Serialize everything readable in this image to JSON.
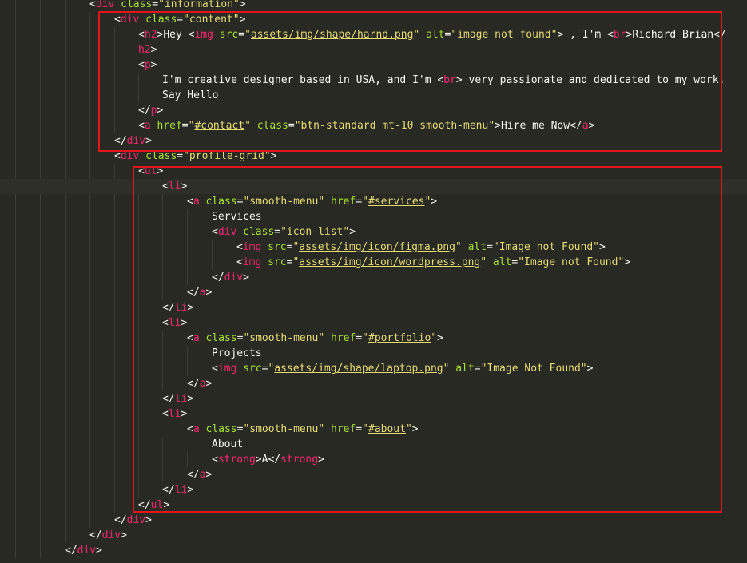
{
  "editor": {
    "colors": {
      "background": "#282923",
      "tag": "#f92672",
      "attribute": "#a6e22e",
      "string": "#e6db74",
      "text": "#f8f8f2",
      "highlight_box": "#e0161b"
    },
    "highlight_boxes": [
      "content block",
      "profile-grid list"
    ],
    "lines": [
      {
        "segments": [
          {
            "t": "punc",
            "v": "<"
          },
          {
            "t": "tag",
            "v": "div"
          },
          {
            "t": "punc",
            "v": " "
          },
          {
            "t": "attr",
            "v": "class"
          },
          {
            "t": "punc",
            "v": "="
          },
          {
            "t": "str",
            "v": "\"information\""
          },
          {
            "t": "punc",
            "v": ">"
          }
        ]
      },
      {
        "segments": [
          {
            "t": "punc",
            "v": "<"
          },
          {
            "t": "tag",
            "v": "div"
          },
          {
            "t": "punc",
            "v": " "
          },
          {
            "t": "attr",
            "v": "class"
          },
          {
            "t": "punc",
            "v": "="
          },
          {
            "t": "str",
            "v": "\"content\""
          },
          {
            "t": "punc",
            "v": ">"
          }
        ]
      },
      {
        "segments": [
          {
            "t": "punc",
            "v": "<"
          },
          {
            "t": "tag",
            "v": "h2"
          },
          {
            "t": "punc",
            "v": ">"
          },
          {
            "t": "text",
            "v": "Hey "
          },
          {
            "t": "punc",
            "v": "<"
          },
          {
            "t": "tag",
            "v": "img"
          },
          {
            "t": "punc",
            "v": " "
          },
          {
            "t": "attr",
            "v": "src"
          },
          {
            "t": "punc",
            "v": "="
          },
          {
            "t": "str",
            "v": "\""
          },
          {
            "t": "link",
            "v": "assets/img/shape/harnd.png"
          },
          {
            "t": "str",
            "v": "\""
          },
          {
            "t": "punc",
            "v": " "
          },
          {
            "t": "attr",
            "v": "alt"
          },
          {
            "t": "punc",
            "v": "="
          },
          {
            "t": "str",
            "v": "\"image not found\""
          },
          {
            "t": "punc",
            "v": ">"
          },
          {
            "t": "text",
            "v": " , I'm "
          },
          {
            "t": "punc",
            "v": "<"
          },
          {
            "t": "tag",
            "v": "br"
          },
          {
            "t": "punc",
            "v": ">"
          },
          {
            "t": "text",
            "v": "Richard Brian"
          },
          {
            "t": "punc",
            "v": "</"
          }
        ]
      },
      {
        "segments": [
          {
            "t": "tag",
            "v": "h2"
          },
          {
            "t": "punc",
            "v": ">"
          }
        ]
      },
      {
        "segments": [
          {
            "t": "punc",
            "v": "<"
          },
          {
            "t": "tag",
            "v": "p"
          },
          {
            "t": "punc",
            "v": ">"
          }
        ]
      },
      {
        "segments": [
          {
            "t": "text",
            "v": "I'm creative designer based in USA, and I'm "
          },
          {
            "t": "punc",
            "v": "<"
          },
          {
            "t": "tag",
            "v": "br"
          },
          {
            "t": "punc",
            "v": ">"
          },
          {
            "t": "text",
            "v": " very passionate and dedicated to my work."
          }
        ]
      },
      {
        "segments": [
          {
            "t": "text",
            "v": "Say Hello"
          }
        ]
      },
      {
        "segments": [
          {
            "t": "punc",
            "v": "</"
          },
          {
            "t": "tag",
            "v": "p"
          },
          {
            "t": "punc",
            "v": ">"
          }
        ]
      },
      {
        "segments": [
          {
            "t": "punc",
            "v": "<"
          },
          {
            "t": "tag",
            "v": "a"
          },
          {
            "t": "punc",
            "v": " "
          },
          {
            "t": "attr",
            "v": "href"
          },
          {
            "t": "punc",
            "v": "="
          },
          {
            "t": "str",
            "v": "\""
          },
          {
            "t": "link",
            "v": "#contact"
          },
          {
            "t": "str",
            "v": "\""
          },
          {
            "t": "punc",
            "v": " "
          },
          {
            "t": "attr",
            "v": "class"
          },
          {
            "t": "punc",
            "v": "="
          },
          {
            "t": "str",
            "v": "\"btn-standard mt-10 smooth-menu\""
          },
          {
            "t": "punc",
            "v": ">"
          },
          {
            "t": "text",
            "v": "Hire me Now"
          },
          {
            "t": "punc",
            "v": "</"
          },
          {
            "t": "tag",
            "v": "a"
          },
          {
            "t": "punc",
            "v": ">"
          }
        ]
      },
      {
        "segments": [
          {
            "t": "punc",
            "v": "</"
          },
          {
            "t": "tag",
            "v": "div"
          },
          {
            "t": "punc",
            "v": ">"
          }
        ]
      },
      {
        "segments": [
          {
            "t": "punc",
            "v": "<"
          },
          {
            "t": "tag",
            "v": "div"
          },
          {
            "t": "punc",
            "v": " "
          },
          {
            "t": "attr",
            "v": "class"
          },
          {
            "t": "punc",
            "v": "="
          },
          {
            "t": "str",
            "v": "\"profile-grid\""
          },
          {
            "t": "punc",
            "v": ">"
          }
        ]
      },
      {
        "segments": [
          {
            "t": "punc",
            "v": "<"
          },
          {
            "t": "tag",
            "v": "ul"
          },
          {
            "t": "punc",
            "v": ">"
          }
        ]
      },
      {
        "segments": [
          {
            "t": "punc",
            "v": "<"
          },
          {
            "t": "tag",
            "v": "li"
          },
          {
            "t": "punc",
            "v": ">"
          }
        ]
      },
      {
        "segments": [
          {
            "t": "punc",
            "v": "<"
          },
          {
            "t": "tag",
            "v": "a"
          },
          {
            "t": "punc",
            "v": " "
          },
          {
            "t": "attr",
            "v": "class"
          },
          {
            "t": "punc",
            "v": "="
          },
          {
            "t": "str",
            "v": "\"smooth-menu\""
          },
          {
            "t": "punc",
            "v": " "
          },
          {
            "t": "attr",
            "v": "href"
          },
          {
            "t": "punc",
            "v": "="
          },
          {
            "t": "str",
            "v": "\""
          },
          {
            "t": "link",
            "v": "#services"
          },
          {
            "t": "str",
            "v": "\""
          },
          {
            "t": "punc",
            "v": ">"
          }
        ]
      },
      {
        "segments": [
          {
            "t": "text",
            "v": "Services"
          }
        ]
      },
      {
        "segments": [
          {
            "t": "punc",
            "v": "<"
          },
          {
            "t": "tag",
            "v": "div"
          },
          {
            "t": "punc",
            "v": " "
          },
          {
            "t": "attr",
            "v": "class"
          },
          {
            "t": "punc",
            "v": "="
          },
          {
            "t": "str",
            "v": "\"icon-list\""
          },
          {
            "t": "punc",
            "v": ">"
          }
        ]
      },
      {
        "segments": [
          {
            "t": "punc",
            "v": "<"
          },
          {
            "t": "tag",
            "v": "img"
          },
          {
            "t": "punc",
            "v": " "
          },
          {
            "t": "attr",
            "v": "src"
          },
          {
            "t": "punc",
            "v": "="
          },
          {
            "t": "str",
            "v": "\""
          },
          {
            "t": "link",
            "v": "assets/img/icon/figma.png"
          },
          {
            "t": "str",
            "v": "\""
          },
          {
            "t": "punc",
            "v": " "
          },
          {
            "t": "attr",
            "v": "alt"
          },
          {
            "t": "punc",
            "v": "="
          },
          {
            "t": "str",
            "v": "\"Image not Found\""
          },
          {
            "t": "punc",
            "v": ">"
          }
        ]
      },
      {
        "segments": [
          {
            "t": "punc",
            "v": "<"
          },
          {
            "t": "tag",
            "v": "img"
          },
          {
            "t": "punc",
            "v": " "
          },
          {
            "t": "attr",
            "v": "src"
          },
          {
            "t": "punc",
            "v": "="
          },
          {
            "t": "str",
            "v": "\""
          },
          {
            "t": "link",
            "v": "assets/img/icon/wordpress.png"
          },
          {
            "t": "str",
            "v": "\""
          },
          {
            "t": "punc",
            "v": " "
          },
          {
            "t": "attr",
            "v": "alt"
          },
          {
            "t": "punc",
            "v": "="
          },
          {
            "t": "str",
            "v": "\"Image not Found\""
          },
          {
            "t": "punc",
            "v": ">"
          }
        ]
      },
      {
        "segments": [
          {
            "t": "punc",
            "v": "</"
          },
          {
            "t": "tag",
            "v": "div"
          },
          {
            "t": "punc",
            "v": ">"
          }
        ]
      },
      {
        "segments": [
          {
            "t": "punc",
            "v": "</"
          },
          {
            "t": "tag",
            "v": "a"
          },
          {
            "t": "punc",
            "v": ">"
          }
        ]
      },
      {
        "segments": [
          {
            "t": "punc",
            "v": "</"
          },
          {
            "t": "tag",
            "v": "li"
          },
          {
            "t": "punc",
            "v": ">"
          }
        ]
      },
      {
        "segments": [
          {
            "t": "punc",
            "v": "<"
          },
          {
            "t": "tag",
            "v": "li"
          },
          {
            "t": "punc",
            "v": ">"
          }
        ]
      },
      {
        "segments": [
          {
            "t": "punc",
            "v": "<"
          },
          {
            "t": "tag",
            "v": "a"
          },
          {
            "t": "punc",
            "v": " "
          },
          {
            "t": "attr",
            "v": "class"
          },
          {
            "t": "punc",
            "v": "="
          },
          {
            "t": "str",
            "v": "\"smooth-menu\""
          },
          {
            "t": "punc",
            "v": " "
          },
          {
            "t": "attr",
            "v": "href"
          },
          {
            "t": "punc",
            "v": "="
          },
          {
            "t": "str",
            "v": "\""
          },
          {
            "t": "link",
            "v": "#portfolio"
          },
          {
            "t": "str",
            "v": "\""
          },
          {
            "t": "punc",
            "v": ">"
          }
        ]
      },
      {
        "segments": [
          {
            "t": "text",
            "v": "Projects"
          }
        ]
      },
      {
        "segments": [
          {
            "t": "punc",
            "v": "<"
          },
          {
            "t": "tag",
            "v": "img"
          },
          {
            "t": "punc",
            "v": " "
          },
          {
            "t": "attr",
            "v": "src"
          },
          {
            "t": "punc",
            "v": "="
          },
          {
            "t": "str",
            "v": "\""
          },
          {
            "t": "link",
            "v": "assets/img/shape/laptop.png"
          },
          {
            "t": "str",
            "v": "\""
          },
          {
            "t": "punc",
            "v": " "
          },
          {
            "t": "attr",
            "v": "alt"
          },
          {
            "t": "punc",
            "v": "="
          },
          {
            "t": "str",
            "v": "\"Image Not Found\""
          },
          {
            "t": "punc",
            "v": ">"
          }
        ]
      },
      {
        "segments": [
          {
            "t": "punc",
            "v": "</"
          },
          {
            "t": "tag",
            "v": "a"
          },
          {
            "t": "punc",
            "v": ">"
          }
        ]
      },
      {
        "segments": [
          {
            "t": "punc",
            "v": "</"
          },
          {
            "t": "tag",
            "v": "li"
          },
          {
            "t": "punc",
            "v": ">"
          }
        ]
      },
      {
        "segments": [
          {
            "t": "punc",
            "v": "<"
          },
          {
            "t": "tag",
            "v": "li"
          },
          {
            "t": "punc",
            "v": ">"
          }
        ]
      },
      {
        "segments": [
          {
            "t": "punc",
            "v": "<"
          },
          {
            "t": "tag",
            "v": "a"
          },
          {
            "t": "punc",
            "v": " "
          },
          {
            "t": "attr",
            "v": "class"
          },
          {
            "t": "punc",
            "v": "="
          },
          {
            "t": "str",
            "v": "\"smooth-menu\""
          },
          {
            "t": "punc",
            "v": " "
          },
          {
            "t": "attr",
            "v": "href"
          },
          {
            "t": "punc",
            "v": "="
          },
          {
            "t": "str",
            "v": "\""
          },
          {
            "t": "link",
            "v": "#about"
          },
          {
            "t": "str",
            "v": "\""
          },
          {
            "t": "punc",
            "v": ">"
          }
        ]
      },
      {
        "segments": [
          {
            "t": "text",
            "v": "About"
          }
        ]
      },
      {
        "segments": [
          {
            "t": "punc",
            "v": "<"
          },
          {
            "t": "tag",
            "v": "strong"
          },
          {
            "t": "punc",
            "v": ">"
          },
          {
            "t": "text",
            "v": "A"
          },
          {
            "t": "punc",
            "v": "</"
          },
          {
            "t": "tag",
            "v": "strong"
          },
          {
            "t": "punc",
            "v": ">"
          }
        ]
      },
      {
        "segments": [
          {
            "t": "punc",
            "v": "</"
          },
          {
            "t": "tag",
            "v": "a"
          },
          {
            "t": "punc",
            "v": ">"
          }
        ]
      },
      {
        "segments": [
          {
            "t": "punc",
            "v": "</"
          },
          {
            "t": "tag",
            "v": "li"
          },
          {
            "t": "punc",
            "v": ">"
          }
        ]
      },
      {
        "segments": [
          {
            "t": "punc",
            "v": "</"
          },
          {
            "t": "tag",
            "v": "ul"
          },
          {
            "t": "punc",
            "v": ">"
          }
        ]
      },
      {
        "segments": [
          {
            "t": "punc",
            "v": "</"
          },
          {
            "t": "tag",
            "v": "div"
          },
          {
            "t": "punc",
            "v": ">"
          }
        ]
      },
      {
        "segments": [
          {
            "t": "punc",
            "v": "</"
          },
          {
            "t": "tag",
            "v": "div"
          },
          {
            "t": "punc",
            "v": ">"
          }
        ]
      },
      {
        "segments": [
          {
            "t": "punc",
            "v": "</"
          },
          {
            "t": "tag",
            "v": "div"
          },
          {
            "t": "punc",
            "v": ">"
          }
        ]
      }
    ]
  }
}
